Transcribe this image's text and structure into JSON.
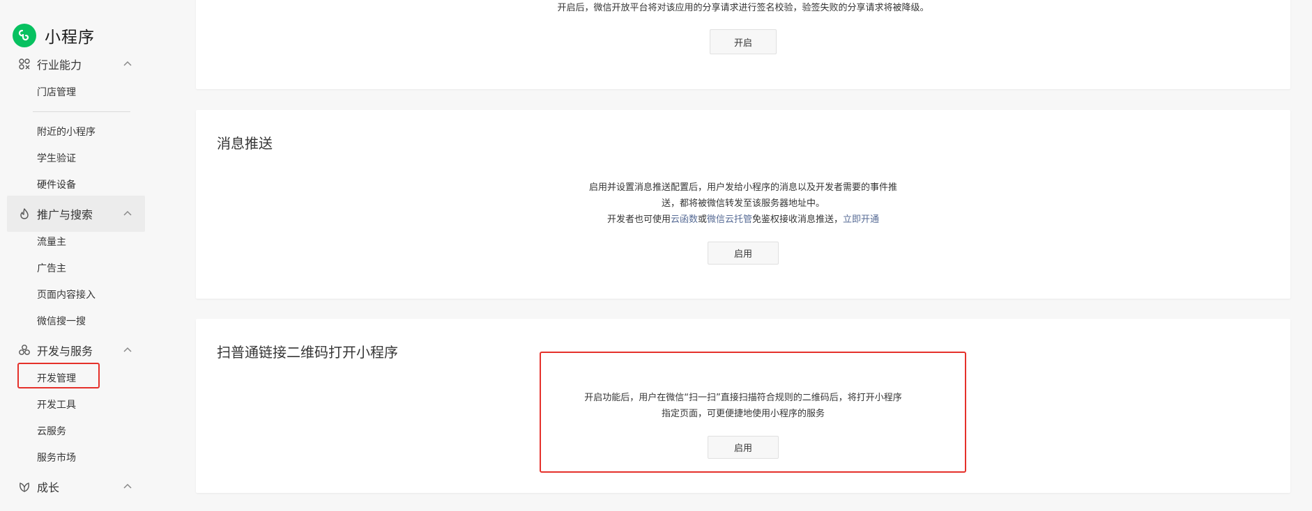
{
  "app": {
    "name": "小程序",
    "accent": "#07c160",
    "link_color": "#576b95",
    "highlight_color": "#e5302a"
  },
  "sidebar": {
    "groups": [
      {
        "label": "行业能力",
        "icon": "industry-icon",
        "items": [
          "门店管理",
          "附近的小程序",
          "学生验证",
          "硬件设备"
        ]
      },
      {
        "label": "推广与搜索",
        "icon": "promotion-icon",
        "items": [
          "流量主",
          "广告主",
          "页面内容接入",
          "微信搜一搜"
        ]
      },
      {
        "label": "开发与服务",
        "icon": "dev-services-icon",
        "items": [
          "开发管理",
          "开发工具",
          "云服务",
          "服务市场"
        ]
      },
      {
        "label": "成长",
        "icon": "growth-icon",
        "items": []
      }
    ],
    "active_group": "推广与搜索",
    "selected_item": "开发管理"
  },
  "cards": {
    "signature": {
      "desc": "开启后，微信开放平台将对该应用的分享请求进行签名校验，验签失败的分享请求将被降级。",
      "button": "开启"
    },
    "message_push": {
      "title": "消息推送",
      "desc_line1": "启用并设置消息推送配置后，用户发给小程序的消息以及开发者需要的事件推",
      "desc_line2": "送，都将被微信转发至该服务器地址中。",
      "desc_line3_a": "开发者也可使用",
      "desc_line3_link1": "云函数",
      "desc_line3_b": "或",
      "desc_line3_link2": "微信云托管",
      "desc_line3_c": "免鉴权接收消息推送，",
      "desc_line3_link3": "立即开通",
      "button": "启用"
    },
    "qr_scan": {
      "title": "扫普通链接二维码打开小程序",
      "desc_line1": "开启功能后，用户在微信“扫一扫”直接扫描符合规则的二维码后，将打开小程序",
      "desc_line2": "指定页面，可更便捷地使用小程序的服务",
      "button": "启用"
    }
  }
}
